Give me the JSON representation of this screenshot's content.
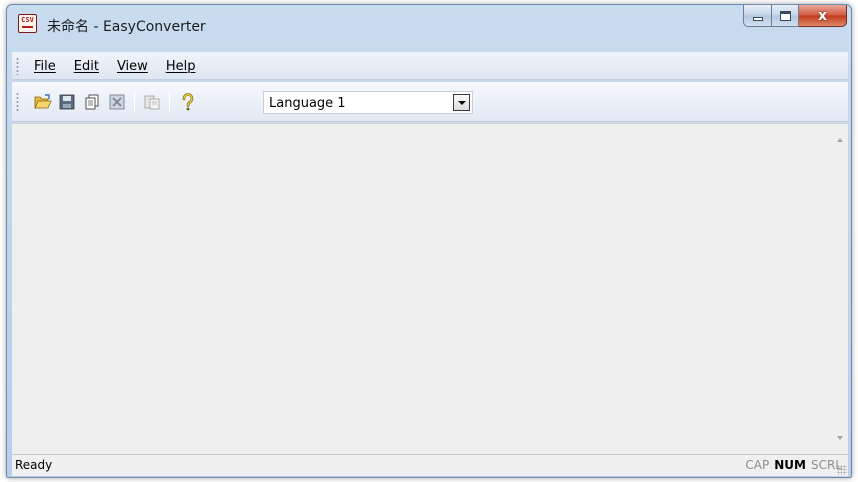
{
  "window": {
    "title": "未命名 - EasyConverter",
    "app_icon_text": "CSV",
    "close_glyph": "x"
  },
  "menu": {
    "items": [
      {
        "label": "File"
      },
      {
        "label": "Edit"
      },
      {
        "label": "View"
      },
      {
        "label": "Help"
      }
    ]
  },
  "toolbar": {
    "icons": [
      "open-folder-icon",
      "save-icon",
      "copy-pages-icon",
      "excel-icon",
      "paste-icon",
      "help-icon"
    ],
    "language": {
      "value": "Language 1"
    }
  },
  "status": {
    "text": "Ready",
    "indicators": [
      {
        "label": "CAP",
        "active": false
      },
      {
        "label": "NUM",
        "active": true
      },
      {
        "label": "SCRL",
        "active": false
      }
    ]
  },
  "colors": {
    "frame": "#b9cfe8",
    "close_button": "#c23b1f",
    "client_background": "#f0efef"
  }
}
